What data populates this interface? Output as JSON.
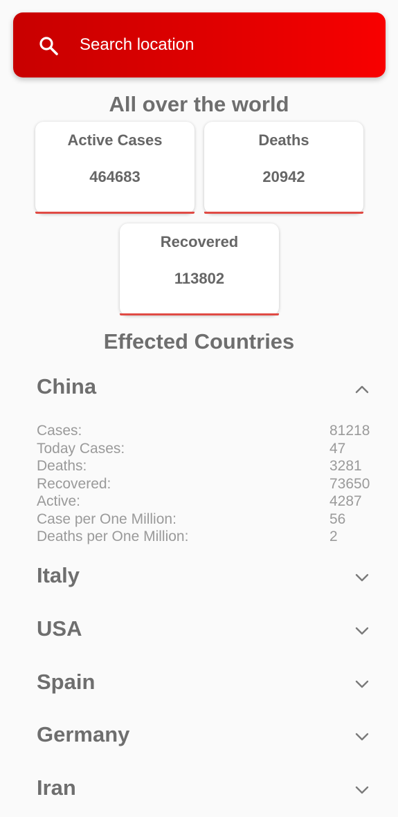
{
  "search": {
    "placeholder": "Search location"
  },
  "world": {
    "title": "All over the world",
    "stats": {
      "active": {
        "label": "Active Cases",
        "value": "464683"
      },
      "deaths": {
        "label": "Deaths",
        "value": "20942"
      },
      "recovered": {
        "label": "Recovered",
        "value": "113802"
      }
    }
  },
  "countries": {
    "title": "Effected Countries",
    "list": [
      {
        "name": "China",
        "expanded": true,
        "icon": "chevron-up-icon",
        "details": [
          {
            "label": "Cases:",
            "value": "81218"
          },
          {
            "label": "Today Cases:",
            "value": "47"
          },
          {
            "label": "Deaths:",
            "value": "3281"
          },
          {
            "label": "Recovered:",
            "value": "73650"
          },
          {
            "label": "Active:",
            "value": "4287"
          },
          {
            "label": "Case per One Million:",
            "value": "56"
          },
          {
            "label": "Deaths per One Million:",
            "value": "2"
          }
        ]
      },
      {
        "name": "Italy",
        "expanded": false,
        "icon": "chevron-down-icon"
      },
      {
        "name": "USA",
        "expanded": false,
        "icon": "chevron-down-icon"
      },
      {
        "name": "Spain",
        "expanded": false,
        "icon": "chevron-down-icon"
      },
      {
        "name": "Germany",
        "expanded": false,
        "icon": "chevron-down-icon"
      },
      {
        "name": "Iran",
        "expanded": false,
        "icon": "chevron-down-icon"
      }
    ]
  },
  "colors": {
    "accent_red": "#e00000",
    "underline_red": "#e04a44",
    "text_gray": "#6e6e6e",
    "detail_gray": "#9a9a9a",
    "background": "#fafafa"
  }
}
